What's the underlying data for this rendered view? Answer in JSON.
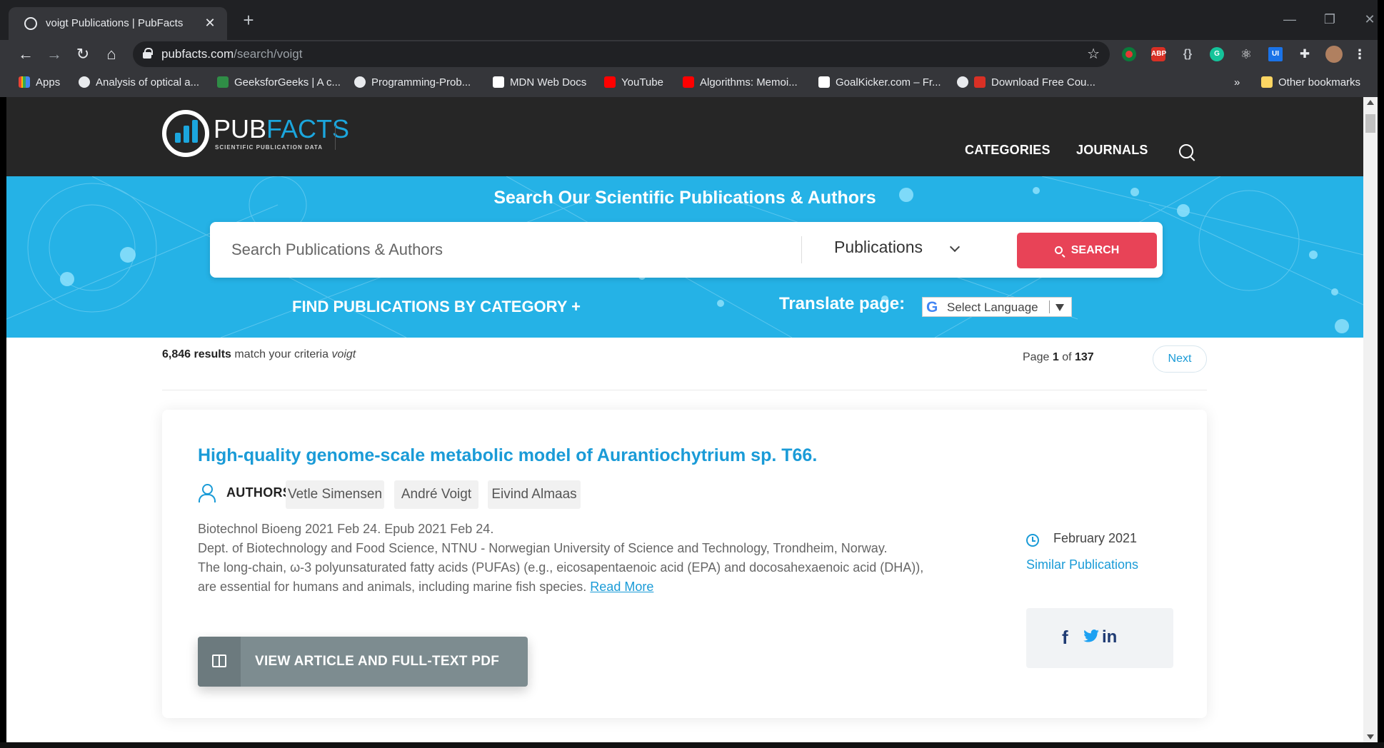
{
  "browser": {
    "tab_title": "voigt Publications | PubFacts",
    "url_host": "pubfacts.com",
    "url_path": "/search/voigt",
    "bookmarks": [
      {
        "label": "Apps"
      },
      {
        "label": "Analysis of optical a..."
      },
      {
        "label": "GeeksforGeeks | A c..."
      },
      {
        "label": "Programming-Prob..."
      },
      {
        "label": "MDN Web Docs"
      },
      {
        "label": "YouTube"
      },
      {
        "label": "Algorithms: Memoi..."
      },
      {
        "label": "GoalKicker.com – Fr..."
      },
      {
        "label": "Download Free Cou..."
      }
    ],
    "overflow_label": "»",
    "other_bookmarks": "Other bookmarks",
    "extensions": [
      "ABP",
      "G",
      "UI"
    ]
  },
  "site": {
    "logo_text_a": "PUB",
    "logo_text_b": "FACTS",
    "logo_tagline": "SCIENTIFIC PUBLICATION DATA",
    "nav": [
      "CATEGORIES",
      "JOURNALS"
    ]
  },
  "hero": {
    "title": "Search Our Scientific Publications & Authors",
    "search_placeholder": "Search Publications & Authors",
    "search_type": "Publications",
    "search_button": "SEARCH",
    "find_by_category": "FIND PUBLICATIONS BY CATEGORY +",
    "translate_label": "Translate page:",
    "language_select": "Select Language"
  },
  "results": {
    "count": "6,846 results",
    "count_suffix": "match your criteria",
    "query": "voigt",
    "page_prefix": "Page",
    "page_current": "1",
    "page_of": "of",
    "page_total": "137",
    "next": "Next"
  },
  "card": {
    "title": "High-quality genome-scale metabolic model of Aurantiochytrium sp. T66.",
    "authors_label": "AUTHORS:",
    "authors": [
      "Vetle Simensen",
      "André Voigt",
      "Eivind Almaas"
    ],
    "journal": "Biotechnol Bioeng 2021 Feb 24. Epub 2021 Feb 24.",
    "affiliation": "Dept. of Biotechnology and Food Science, NTNU - Norwegian University of Science and Technology, Trondheim, Norway.",
    "abstract": "The long-chain, ω-3 polyunsaturated fatty acids (PUFAs) (e.g., eicosapentaenoic acid (EPA) and docosahexaenoic acid (DHA)), are essential for humans and animals, including marine fish species.",
    "read_more": "Read More",
    "date": "February 2021",
    "similar": "Similar Publications",
    "share": [
      "f",
      "in"
    ],
    "view_button": "VIEW ARTICLE AND FULL-TEXT PDF"
  },
  "colors": {
    "accent_blue": "#1a9bd7",
    "hero_blue": "#25b2e6",
    "search_red": "#e84357",
    "header_dark": "#262626"
  }
}
